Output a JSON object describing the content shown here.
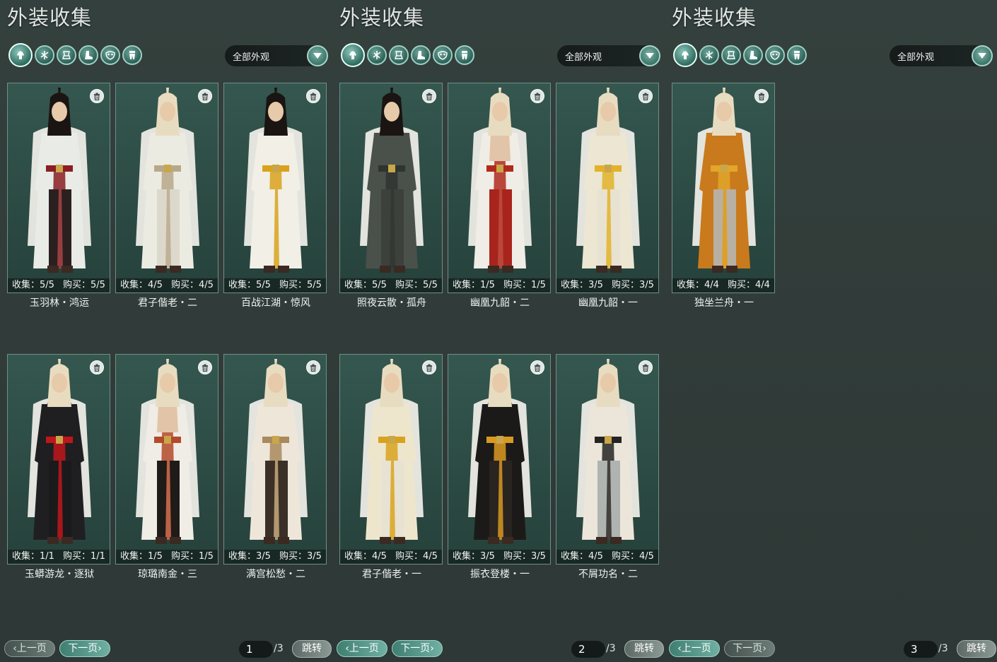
{
  "panels": [
    {
      "title": "外装收集",
      "dropdown": "全部外观",
      "page": "1",
      "total": "/3",
      "prev_label": "上一页",
      "next_label": "下一页",
      "jump_label": "跳转",
      "cards": [
        {
          "collect": "收集：5/5",
          "buy": "购买：5/5",
          "name": "玉羽林・鸿运",
          "robe": "#e9ebe6",
          "accent": "#8a1e22",
          "pants": "#2a2020",
          "hair": "#1a1412"
        },
        {
          "collect": "收集：4/5",
          "buy": "购买：4/5",
          "name": "君子偕老・二",
          "robe": "#ecebe2",
          "accent": "#b8a88a",
          "pants": "#dcd8cc",
          "hair": "#e8dcc0"
        },
        {
          "collect": "收集：5/5",
          "buy": "购买：5/5",
          "name": "百战江湖・惊风",
          "robe": "#f1efe6",
          "accent": "#d9a21c",
          "pants": "#f1efe6",
          "hair": "#1a1412"
        },
        {
          "collect": "收集：1/1",
          "buy": "购买：1/1",
          "name": "玉蟒游龙・逐狱",
          "robe": "#1f1f22",
          "accent": "#c0161a",
          "pants": "#1a1a1c",
          "hair": "#e8dcc0"
        },
        {
          "collect": "收集：1/5",
          "buy": "购买：1/5",
          "name": "琼璐南金・三",
          "robe": "#f0ece6",
          "accent": "#b34a2a",
          "pants": "#1f1b18",
          "hair": "#e8dcc0",
          "bare": true
        },
        {
          "collect": "收集：3/5",
          "buy": "购买：3/5",
          "name": "满宫松愁・二",
          "robe": "#efe6da",
          "accent": "#a88a5c",
          "pants": "#3a3028",
          "hair": "#e8dcc0"
        }
      ]
    },
    {
      "title": "外装收集",
      "dropdown": "全部外观",
      "page": "2",
      "total": "/3",
      "prev_label": "上一页",
      "next_label": "下一页",
      "jump_label": "跳转",
      "cards": [
        {
          "collect": "收集：5/5",
          "buy": "购买：5/5",
          "name": "照夜云散・孤舟",
          "robe": "#4a504a",
          "accent": "#2f3430",
          "pants": "#3c413c",
          "hair": "#1a1412"
        },
        {
          "collect": "收集：1/5",
          "buy": "购买：1/5",
          "name": "幽凰九韶・二",
          "robe": "#f0ece6",
          "accent": "#b02a1c",
          "pants": "#a8241c",
          "hair": "#e8dcc0",
          "bare": true
        },
        {
          "collect": "收集：3/5",
          "buy": "购买：3/5",
          "name": "幽凰九韶・一",
          "robe": "#ece6d2",
          "accent": "#e2b22a",
          "pants": "#e8e2d2",
          "hair": "#e8dcc0"
        },
        {
          "collect": "收集：4/5",
          "buy": "购买：4/5",
          "name": "君子偕老・一",
          "robe": "#eee6cc",
          "accent": "#d8a21e",
          "pants": "#e8e2d2",
          "hair": "#e8dcc0"
        },
        {
          "collect": "收集：3/5",
          "buy": "购买：3/5",
          "name": "振衣登楼・一",
          "robe": "#1c1a18",
          "accent": "#d99a22",
          "pants": "#2a2420",
          "hair": "#e8dcc0"
        },
        {
          "collect": "收集：4/5",
          "buy": "购买：4/5",
          "name": "不屑功名・二",
          "robe": "#ece6da",
          "accent": "#262422",
          "pants": "#b0b4b0",
          "hair": "#e8dcc0"
        }
      ]
    },
    {
      "title": "外装收集",
      "dropdown": "全部外观",
      "page": "3",
      "total": "/3",
      "prev_label": "上一页",
      "next_label": "下一页",
      "jump_label": "跳转",
      "cards": [
        {
          "collect": "收集：4/4",
          "buy": "购买：4/4",
          "name": "独坐兰舟・一",
          "robe": "#c97a1c",
          "accent": "#e2a62a",
          "pants": "#b8b0a2",
          "hair": "#e8dcc0"
        }
      ]
    }
  ],
  "filter_icons": [
    "outfit-icon",
    "hat-icon",
    "robe-icon",
    "boots-icon",
    "mask-icon",
    "pants-icon"
  ],
  "colors": {
    "accent": "#3f7f72",
    "card_bg": "#2b4a43",
    "panel_bg": "#34403d"
  }
}
